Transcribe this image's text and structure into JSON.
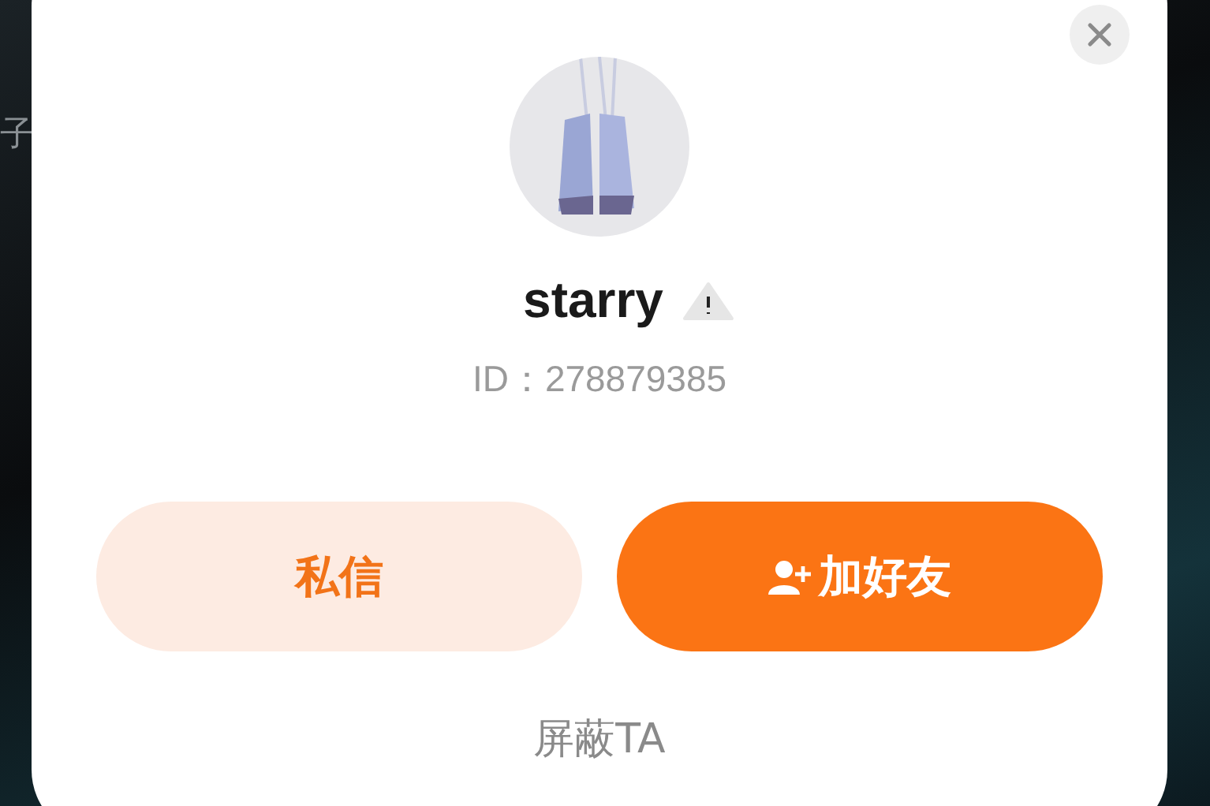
{
  "background": {
    "text": "子"
  },
  "profile": {
    "username": "starry",
    "user_id": "ID：278879385"
  },
  "buttons": [
    {
      "label": "私信",
      "kind": "secondary"
    },
    {
      "label": "加好友",
      "kind": "primary"
    }
  ],
  "block_link": "屏蔽TA"
}
